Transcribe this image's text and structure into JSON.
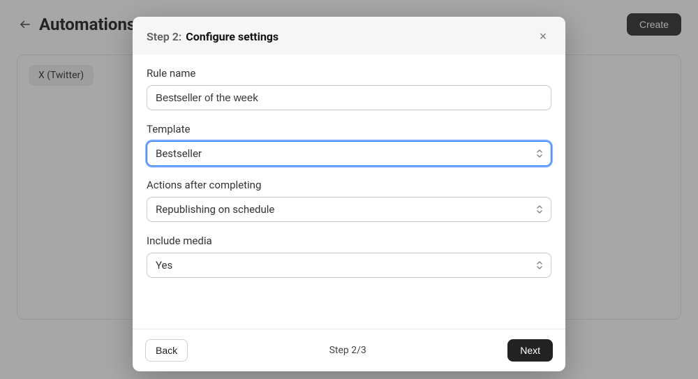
{
  "page": {
    "title": "Automations",
    "tag": "X (Twitter)",
    "create_label": "Create"
  },
  "modal": {
    "step_prefix": "Step 2:",
    "title": "Configure settings",
    "close_glyph": "×",
    "footer": {
      "back_label": "Back",
      "next_label": "Next",
      "step_indicator": "Step 2/3"
    },
    "fields": {
      "rule_name": {
        "label": "Rule name",
        "value": "Bestseller of the week"
      },
      "template": {
        "label": "Template",
        "value": "Bestseller"
      },
      "actions": {
        "label": "Actions after completing",
        "value": "Republishing on schedule"
      },
      "include_media": {
        "label": "Include media",
        "value": "Yes"
      }
    }
  }
}
